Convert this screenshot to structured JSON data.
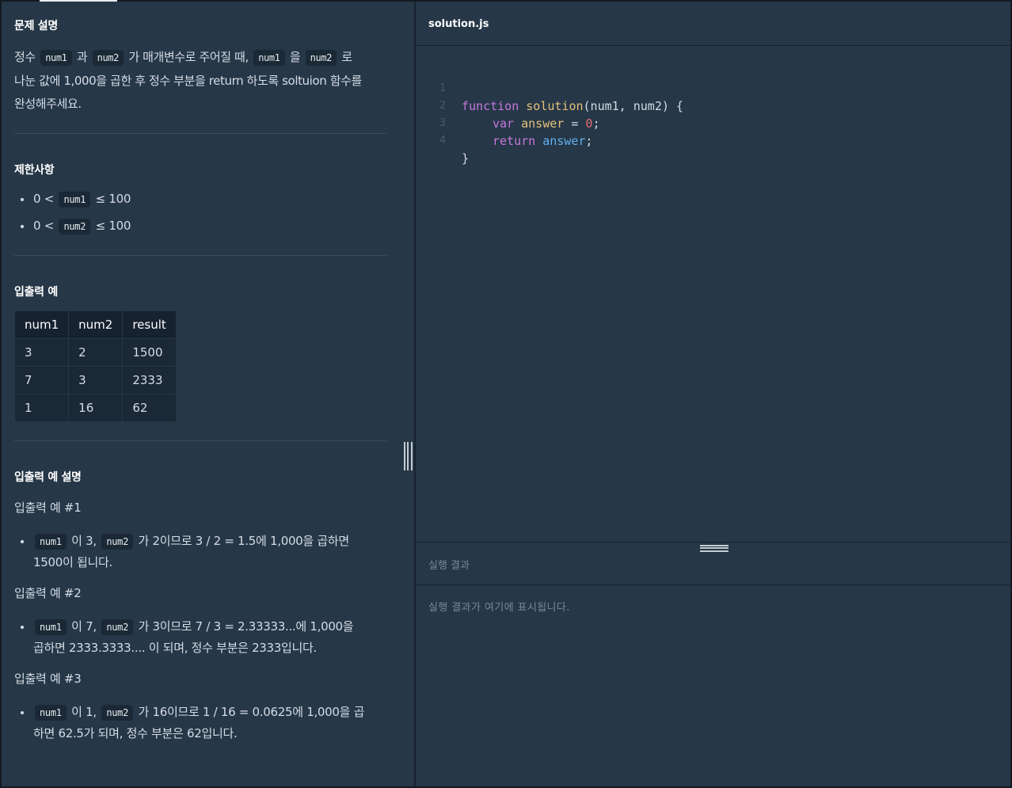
{
  "description": {
    "title": "문제 설명",
    "p1_a": "정수",
    "p1_code1": "num1",
    "p1_b": "과",
    "p1_code2": "num2",
    "p1_c": "가 매개변수로 주어질 때,",
    "p1_code3": "num1",
    "p1_d": "을",
    "p1_code4": "num2",
    "p1_e": "로",
    "p2": "나눈 값에 1,000을 곱한 후 정수 부분을 return 하도록 soltuion 함수를",
    "p3": "완성해주세요."
  },
  "constraints": {
    "title": "제한사항",
    "items": [
      {
        "pre": "0 <",
        "code": "num1",
        "post": "≤ 100"
      },
      {
        "pre": "0 <",
        "code": "num2",
        "post": "≤ 100"
      }
    ]
  },
  "examples": {
    "title": "입출력 예",
    "headers": [
      "num1",
      "num2",
      "result"
    ],
    "rows": [
      [
        "3",
        "2",
        "1500"
      ],
      [
        "7",
        "3",
        "2333"
      ],
      [
        "1",
        "16",
        "62"
      ]
    ]
  },
  "explanation": {
    "title": "입출력 예 설명",
    "ex1_title": "입출력 예 #1",
    "ex1_code1": "num1",
    "ex1_a": "이 3,",
    "ex1_code2": "num2",
    "ex1_b": "가 2이므로 3 / 2 = 1.5에 1,000을 곱하면",
    "ex1_c": "1500이 됩니다.",
    "ex2_title": "입출력 예 #2",
    "ex2_code1": "num1",
    "ex2_a": "이 7,",
    "ex2_code2": "num2",
    "ex2_b": "가 3이므로 7 / 3 = 2.33333...에 1,000을",
    "ex2_c": "곱하면 2333.3333.... 이 되며, 정수 부분은 2333입니다.",
    "ex3_title": "입출력 예 #3",
    "ex3_code1": "num1",
    "ex3_a": "이 1,",
    "ex3_code2": "num2",
    "ex3_b": "가 16이므로 1 / 16 = 0.0625에 1,000을 곱",
    "ex3_c": "하면 62.5가 되며, 정수 부분은 62입니다."
  },
  "editor": {
    "filename": "solution.js",
    "lines": [
      {
        "n": "1",
        "kw": "function",
        "fn": "solution",
        "rest": "(num1, num2) {"
      },
      {
        "n": "2",
        "kw": "var",
        "fn": "answer",
        "eq": " = ",
        "num": "0",
        "end": ";"
      },
      {
        "n": "3",
        "kw": "return",
        "var": "answer",
        "end": ";"
      },
      {
        "n": "4",
        "text": "}"
      }
    ]
  },
  "result": {
    "label": "실행 결과",
    "placeholder": "실행 결과가 여기에 표시됩니다."
  }
}
